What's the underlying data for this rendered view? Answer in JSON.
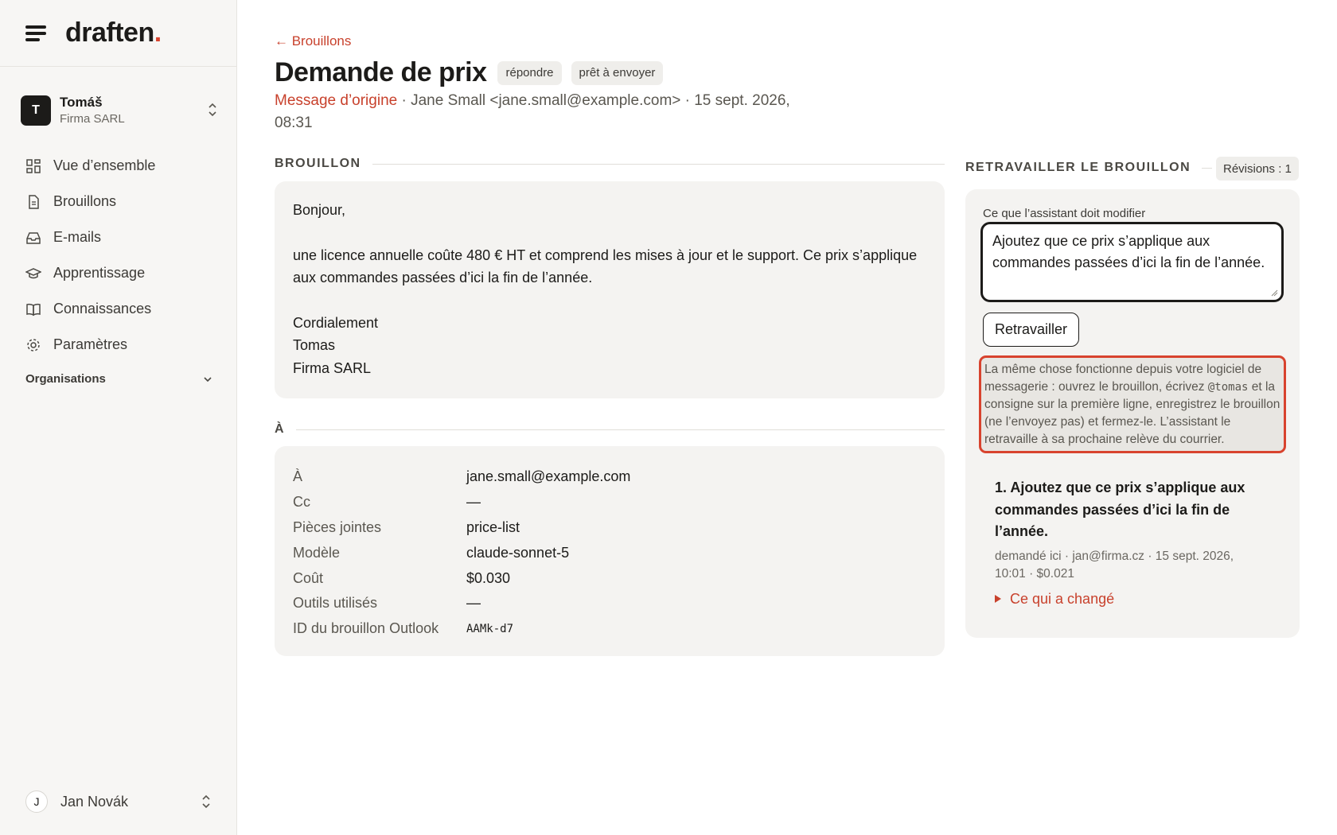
{
  "brand": {
    "name": "draften",
    "dot": "."
  },
  "org": {
    "initial": "T",
    "name": "Tomáš",
    "company": "Firma SARL"
  },
  "nav": [
    {
      "label": "Vue d’ensemble",
      "icon": "grid-icon"
    },
    {
      "label": "Brouillons",
      "icon": "document-icon"
    },
    {
      "label": "E-mails",
      "icon": "inbox-icon"
    },
    {
      "label": "Apprentissage",
      "icon": "graduation-cap-icon"
    },
    {
      "label": "Connaissances",
      "icon": "book-icon"
    },
    {
      "label": "Paramètres",
      "icon": "gear-icon"
    }
  ],
  "organisations_label": "Organisations",
  "user": {
    "initial": "J",
    "name": "Jan Novák"
  },
  "page": {
    "back": "← Brouillons",
    "title": "Demande de prix",
    "tags": [
      "répondre",
      "prêt à envoyer"
    ],
    "origin_link": "Message d’origine",
    "origin_rest": " · Jane Small <jane.small@example.com> · 15 sept. 2026, 08:31"
  },
  "draft": {
    "label": "BROUILLON",
    "greeting": "Bonjour,",
    "body": "une licence annuelle coûte 480 € HT et comprend les mises à jour et le support. Ce prix s’applique aux commandes passées d’ici la fin de l’année.",
    "closing": "Cordialement",
    "signature_name": "Tomas",
    "signature_company": "Firma SARL"
  },
  "details": {
    "label": "À",
    "rows": [
      {
        "key": "À",
        "value": "jane.small@example.com"
      },
      {
        "key": "Cc",
        "value": "—"
      },
      {
        "key": "Pièces jointes",
        "value": "price-list"
      },
      {
        "key": "Modèle",
        "value": "claude-sonnet-5"
      },
      {
        "key": "Coût",
        "value": "$0.030"
      },
      {
        "key": "Outils utilisés",
        "value": "—"
      },
      {
        "key": "ID du brouillon Outlook",
        "value": "AAMk-d7"
      }
    ]
  },
  "rework": {
    "label": "RETRAVAILLER LE BROUILLON",
    "revisions": "Révisions : 1",
    "field_label": "Ce que l’assistant doit modifier",
    "field_value": "Ajoutez que ce prix s’applique aux commandes passées d’ici la fin de l’année.",
    "button": "Retravailler",
    "hint_before": "La même chose fonctionne depuis votre logiciel de messagerie : ouvrez le brouillon, écrivez ",
    "hint_code": "@tomas",
    "hint_after": " et la consigne sur la première ligne, enregistrez le brouillon (ne l’envoyez pas) et fermez-le. L’assistant le retravaille à sa prochaine relève du courrier.",
    "revision_item": {
      "text": "1. Ajoutez que ce prix s’applique aux commandes passées d’ici la fin de l’année.",
      "meta": "demandé ici · jan@firma.cz · 15 sept. 2026, 10:01 · $0.021",
      "toggle": "Ce qui a changé"
    }
  },
  "colors": {
    "accent": "#c8412c",
    "highlight_border": "#d8432e",
    "card_bg": "#f4f3f1"
  }
}
